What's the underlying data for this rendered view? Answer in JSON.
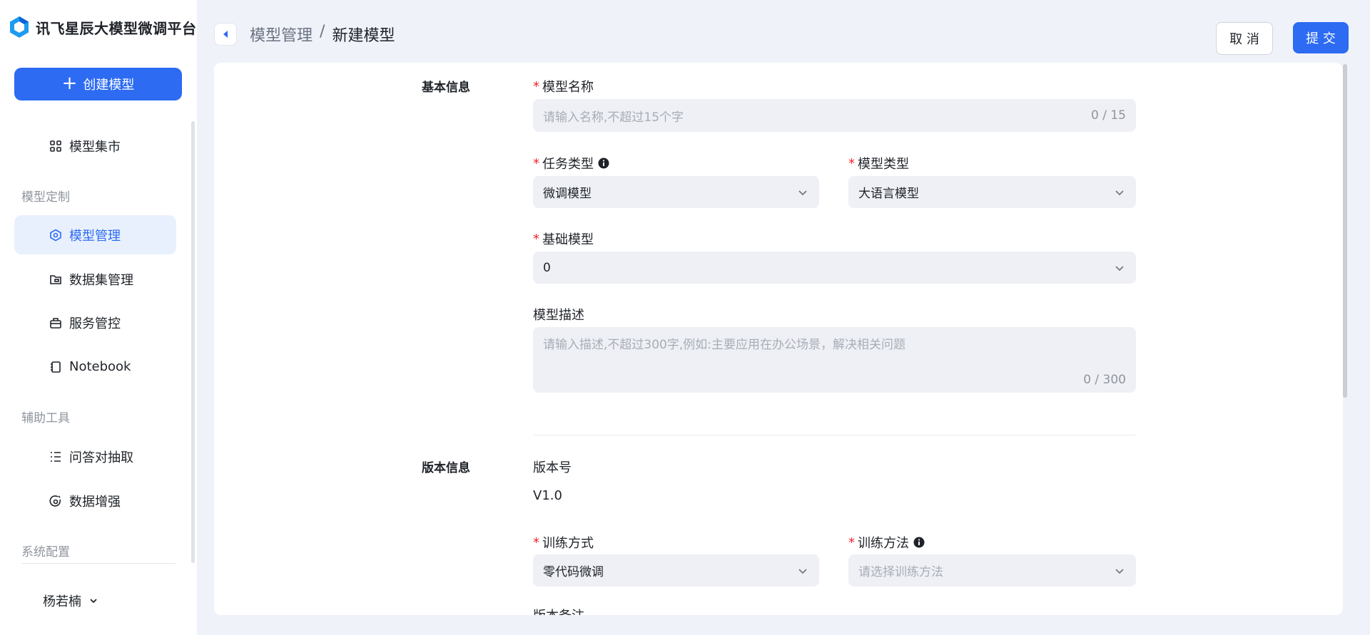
{
  "app": {
    "title": "讯飞星辰大模型微调平台"
  },
  "colors": {
    "accent": "#2c6bf2",
    "required": "#f5222d",
    "sidebar_active_bg": "#e9f0fd"
  },
  "sidebar": {
    "create_button": "创建模型",
    "market": {
      "label": "模型集市",
      "icon": "grid-icon"
    },
    "section_custom": "模型定制",
    "items": [
      {
        "label": "模型管理",
        "icon": "model-icon",
        "active": true
      },
      {
        "label": "数据集管理",
        "icon": "dataset-icon"
      },
      {
        "label": "服务管控",
        "icon": "service-icon"
      },
      {
        "label": "Notebook",
        "icon": "notebook-icon"
      }
    ],
    "section_tools": "辅助工具",
    "tools": [
      {
        "label": "问答对抽取",
        "icon": "list-icon"
      },
      {
        "label": "数据增强",
        "icon": "enhance-icon"
      }
    ],
    "section_config": "系统配置",
    "user": "杨若楠"
  },
  "header": {
    "breadcrumb": {
      "parent": "模型管理",
      "separator": "/",
      "current": "新建模型"
    },
    "cancel": "取 消",
    "submit": "提 交"
  },
  "form": {
    "basic": {
      "title": "基本信息",
      "name": {
        "label": "模型名称",
        "placeholder": "请输入名称,不超过15个字",
        "counter": "0 / 15"
      },
      "task_type": {
        "label": "任务类型",
        "value": "微调模型"
      },
      "model_type": {
        "label": "模型类型",
        "value": "大语言模型"
      },
      "base_model": {
        "label": "基础模型",
        "value": "0"
      },
      "description": {
        "label": "模型描述",
        "placeholder": "请输入描述,不超过300字,例如:主要应用在办公场景，解决相关问题",
        "counter": "0 / 300"
      }
    },
    "version": {
      "title": "版本信息",
      "version_no": {
        "label": "版本号",
        "value": "V1.0"
      },
      "train_mode": {
        "label": "训练方式",
        "value": "零代码微调"
      },
      "train_method": {
        "label": "训练方法",
        "placeholder": "请选择训练方法"
      },
      "version_note": {
        "label": "版本备注"
      }
    }
  }
}
